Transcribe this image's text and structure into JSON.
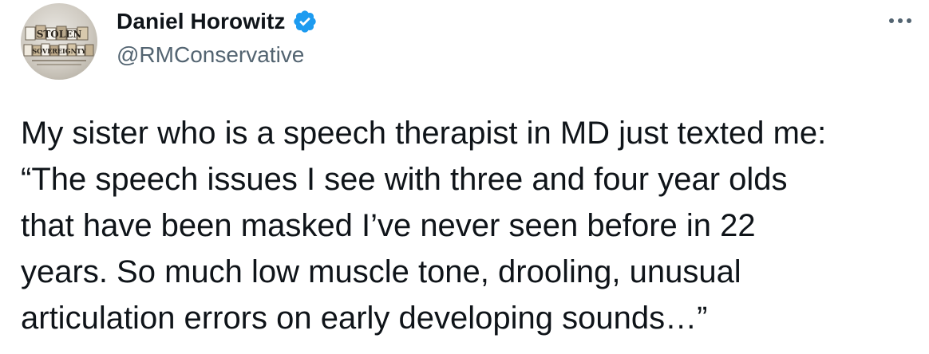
{
  "author": {
    "display_name": "Daniel Horowitz",
    "handle": "@RMConservative",
    "verified": true,
    "avatar_text": {
      "line1": "STOLEN",
      "line2": "SOVEREIGNTY"
    }
  },
  "tweet": {
    "lines": [
      "My sister who is a speech therapist in MD just texted me:",
      "“The speech issues I see with three and four year olds",
      "that have been masked I’ve never seen before in 22",
      "years. So much low muscle tone, drooling, unusual",
      "articulation errors on early developing sounds…”"
    ]
  },
  "colors": {
    "verified_badge": "#1d9bf0",
    "text_primary": "#0f1419",
    "text_secondary": "#536471"
  },
  "icons": {
    "verified": "verified-badge-icon",
    "more": "more-options-icon"
  }
}
